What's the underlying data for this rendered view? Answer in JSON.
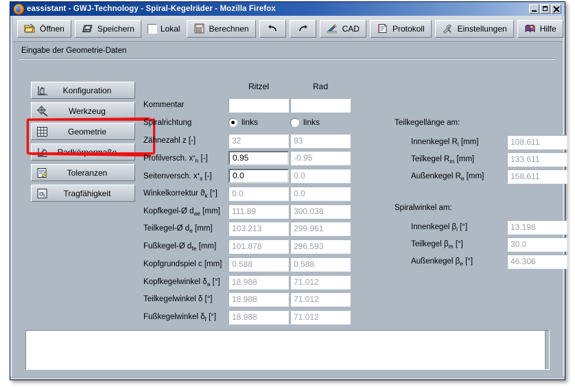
{
  "window": {
    "title": "eassistant - GWJ-Technology - Spiral-Kegelräder - Mozilla Firefox",
    "app_icon": "firefox-icon",
    "controls": {
      "minimize": "minimize-icon",
      "maximize": "maximize-icon",
      "close": "close-icon"
    }
  },
  "toolbar": {
    "buttons": [
      {
        "label": "Öffnen",
        "icon": "open-folder-icon"
      },
      {
        "label": "Speichern",
        "icon": "floppy-disk-icon"
      },
      {
        "label": "Berechnen",
        "icon": "calculator-icon"
      },
      {
        "label": "",
        "icon": "undo-arrow-icon"
      },
      {
        "label": "",
        "icon": "redo-arrow-icon"
      },
      {
        "label": "CAD",
        "icon": "cad-pencil-icon"
      },
      {
        "label": "Protokoll",
        "icon": "document-icon"
      },
      {
        "label": "Einstellungen",
        "icon": "settings-tools-icon"
      },
      {
        "label": "Hilfe",
        "icon": "help-book-icon"
      }
    ],
    "checkbox": {
      "label": "Lokal",
      "checked": false
    }
  },
  "section": {
    "title": "Eingabe der Geometrie-Daten"
  },
  "sidebar": {
    "items": [
      {
        "label": "Konfiguration",
        "icon": "configuration-icon",
        "selected": false
      },
      {
        "label": "Werkzeug",
        "icon": "gear-tool-icon",
        "selected": false
      },
      {
        "label": "Geometrie",
        "icon": "grid-geometry-icon",
        "selected": true
      },
      {
        "label": "Radkörpermaße",
        "icon": "wheel-body-icon",
        "selected": false
      },
      {
        "label": "Toleranzen",
        "icon": "tolerances-icon",
        "selected": false
      },
      {
        "label": "Tragfähigkeit",
        "icon": "sigma-strength-icon",
        "selected": false
      }
    ]
  },
  "form": {
    "columns": [
      "Ritzel",
      "Rad"
    ],
    "rows": [
      {
        "label": "Kommentar",
        "label_html": "Kommentar",
        "type": "text",
        "ritzel": "",
        "rad": "",
        "editable": true,
        "empty": true
      },
      {
        "label": "Spiralrichtung",
        "label_html": "Spiralrichtung",
        "type": "radio",
        "ritzel": "links",
        "rad": "links",
        "ritzel_selected": true,
        "rad_selected": false
      },
      {
        "label": "Zähnezahl z [-]",
        "label_html": "Zähnezahl z [-]",
        "type": "text",
        "ritzel": "32",
        "rad": "93",
        "editable": false
      },
      {
        "label": "Profilversch. x*h [-]",
        "label_html": "Profilversch. x<sup>*</sup><sub>h</sub> [-]",
        "type": "text",
        "ritzel": "0.95",
        "rad": "-0.95",
        "editable": true
      },
      {
        "label": "Seitenversch. x*s [-]",
        "label_html": "Seitenversch. x<sup>*</sup><sub>s</sub> [-]",
        "type": "text",
        "ritzel": "0.0",
        "rad": "0.0",
        "editable": true
      },
      {
        "label": "Winkelkorrektur ϑk [°]",
        "label_html": "Winkelkorrektur ϑ<sub>k</sub> [°]",
        "type": "text",
        "ritzel": "0.0",
        "rad": "0.0",
        "editable": false
      },
      {
        "label": "Kopfkegel-Ø dae [mm]",
        "label_html": "Kopfkegel-Ø d<sub>ae</sub> [mm]",
        "type": "text",
        "ritzel": "111.89",
        "rad": "300.038",
        "editable": false
      },
      {
        "label": "Teilkegel-Ø de [mm]",
        "label_html": "Teilkegel-Ø d<sub>e</sub> [mm]",
        "type": "text",
        "ritzel": "103.213",
        "rad": "299.961",
        "editable": false
      },
      {
        "label": "Fußkegel-Ø dfe [mm]",
        "label_html": "Fußkegel-Ø d<sub>fe</sub> [mm]",
        "type": "text",
        "ritzel": "101.878",
        "rad": "296.593",
        "editable": false
      },
      {
        "label": "Kopfgrundspiel c [mm]",
        "label_html": "Kopfgrundspiel c [mm]",
        "type": "text",
        "ritzel": "0.588",
        "rad": "0.588",
        "editable": false
      },
      {
        "label": "Kopfkegelwinkel δa [°]",
        "label_html": "Kopfkegelwinkel δ<sub>a</sub> [°]",
        "type": "text",
        "ritzel": "18.988",
        "rad": "71.012",
        "editable": false
      },
      {
        "label": "Teilkegelwinkel δ [°]",
        "label_html": "Teilkegelwinkel δ [°]",
        "type": "text",
        "ritzel": "18.988",
        "rad": "71.012",
        "editable": false
      },
      {
        "label": "Fußkegelwinkel δf [°]",
        "label_html": "Fußkegelwinkel δ<sub>f</sub> [°]",
        "type": "text",
        "ritzel": "18.988",
        "rad": "71.012",
        "editable": false
      }
    ]
  },
  "right_panel": {
    "group1": {
      "title": "Teilkegellänge am:",
      "rows": [
        {
          "label_html": "Innenkegel R<sub>i</sub> [mm]",
          "value": "108.611"
        },
        {
          "label_html": "Teilkegel R<sub>m</sub> [mm]",
          "value": "133.611"
        },
        {
          "label_html": "Außenkegel R<sub>e</sub> [mm]",
          "value": "158.611"
        }
      ]
    },
    "group2": {
      "title": "Spiralwinkel am:",
      "rows": [
        {
          "label_html": "Innenkegel β<sub>i</sub> [°]",
          "value": "13.198"
        },
        {
          "label_html": "Teilkegel β<sub>m</sub> [°]",
          "value": "30.0"
        },
        {
          "label_html": "Außenkegel β<sub>e</sub> [°]",
          "value": "46.306"
        }
      ]
    }
  },
  "output": {
    "text": ""
  },
  "annotation": {
    "color": "#ee1111",
    "target": "Geometrie"
  },
  "colors": {
    "window_background": "#aeb9c4",
    "toolbar": "#c6cdd6",
    "titlebar_start": "#0b3c8c",
    "titlebar_end": "#b6cbe6",
    "readonly_text": "#9aa0a7",
    "annotation": "#ee1111"
  }
}
